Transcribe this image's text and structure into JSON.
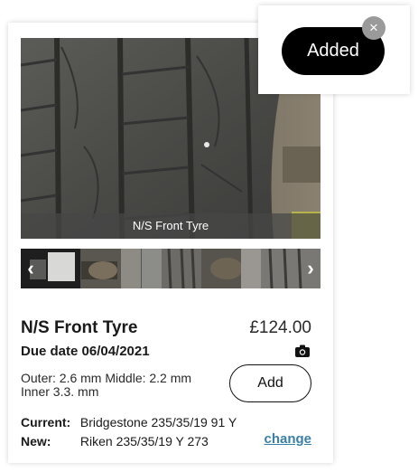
{
  "item": {
    "photo_caption": "N/S Front Tyre",
    "title": "N/S Front Tyre",
    "price": "£124.00",
    "due_date": "Due date 06/04/2021",
    "measurements": "Outer: 2.6 mm Middle: 2.2 mm Inner 3.3. mm",
    "add_label": "Add",
    "current_label": "Current:",
    "current_value": "Bridgestone 235/35/19 91 Y",
    "new_label": "New:",
    "new_value": "Riken 235/35/19 Y 273",
    "change_label": "change"
  },
  "gallery": {
    "prev_arrow": "‹",
    "next_arrow": "›",
    "thumbnail_count": 4,
    "selected_index": 0
  },
  "toast": {
    "message": "Added",
    "close_glyph": "×"
  },
  "icons": {
    "camera": "camera-icon",
    "close": "close-icon",
    "prev": "chevron-left-icon",
    "next": "chevron-right-icon"
  },
  "colors": {
    "link": "#3a7fa6",
    "toast_pill": "#000000",
    "close_button": "#9a9a9a"
  }
}
